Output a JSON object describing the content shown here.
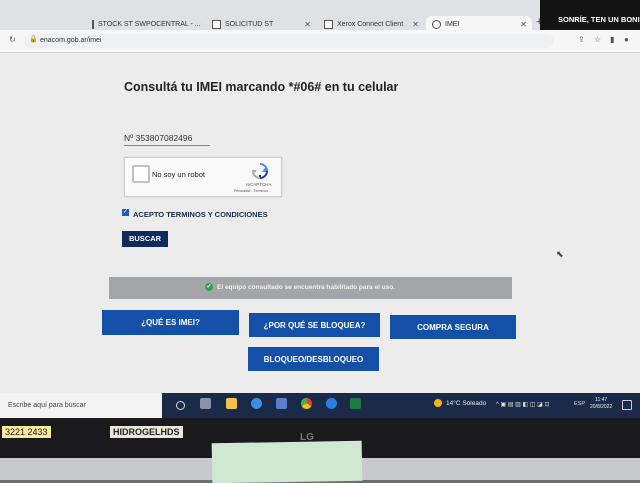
{
  "browser": {
    "tabs": [
      {
        "label": "STOCK ST SWPOCENTRAL - ...",
        "active": false
      },
      {
        "label": "SOLICITUD ST",
        "active": false
      },
      {
        "label": "Xerox Connect Client",
        "active": false
      },
      {
        "label": "IMEI",
        "active": true
      }
    ],
    "new_tab_icon": "plus-icon",
    "url": "enacom.gob.ar/imei"
  },
  "banner": {
    "text": "SONRÍE, TEN UN BONI"
  },
  "page": {
    "heading": "Consultá tu IMEI marcando *#06# en tu celular",
    "imei_value": "Nº 353807082496",
    "captcha": {
      "label": "No soy un robot",
      "brand": "reCAPTCHA",
      "links": "Privacidad - Términos",
      "checked": false
    },
    "terms": {
      "label": "ACEPTO TERMINOS Y CONDICIONES",
      "checked": true
    },
    "search_button": "BUSCAR",
    "result_message": "El equipo consultado se encuentra habilitado para el uso.",
    "nav_buttons": {
      "que_es_imei": "¿QUÉ ES IMEI?",
      "por_que_se_bloquea": "¿POR QUÉ SE BLOQUEA?",
      "compra_segura": "COMPRA SEGURA",
      "bloqueo_desbloqueo": "BLOQUEO/DESBLOQUEO"
    }
  },
  "taskbar": {
    "search_placeholder": "Escribe aquí para buscar",
    "weather": "14°C  Soleado",
    "language": "ESP",
    "time": "11:47",
    "date": "20/8/2022"
  },
  "monitor": {
    "brand": "LG"
  },
  "desk_notes": {
    "note1": "3221 2433",
    "note2": "HIDROGELHDS"
  },
  "colors": {
    "primary_button": "#1550a8",
    "dark_button": "#0f2a5c",
    "taskbar": "#1b2a48"
  }
}
